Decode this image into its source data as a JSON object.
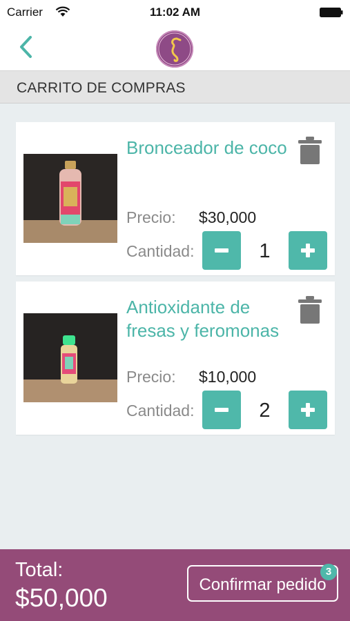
{
  "status_bar": {
    "carrier": "Carrier",
    "time": "11:02 AM"
  },
  "nav": {
    "back_icon": "chevron-left-icon",
    "logo_icon": "seahorse-logo"
  },
  "section": {
    "title": "CARRITO DE COMPRAS"
  },
  "labels": {
    "price": "Precio:",
    "quantity": "Cantidad:"
  },
  "cart_items": [
    {
      "name": "Bronceador de coco",
      "price": "$30,000",
      "quantity": "1"
    },
    {
      "name": "Antioxidante de fresas y feromonas",
      "price": "$10,000",
      "quantity": "2"
    }
  ],
  "footer": {
    "total_label": "Total:",
    "total_value": "$50,000",
    "confirm_label": "Confirmar pedido",
    "badge_count": "3"
  },
  "colors": {
    "accent_teal": "#4fb8aa",
    "footer_plum": "#944b78",
    "background": "#e9eef0"
  }
}
